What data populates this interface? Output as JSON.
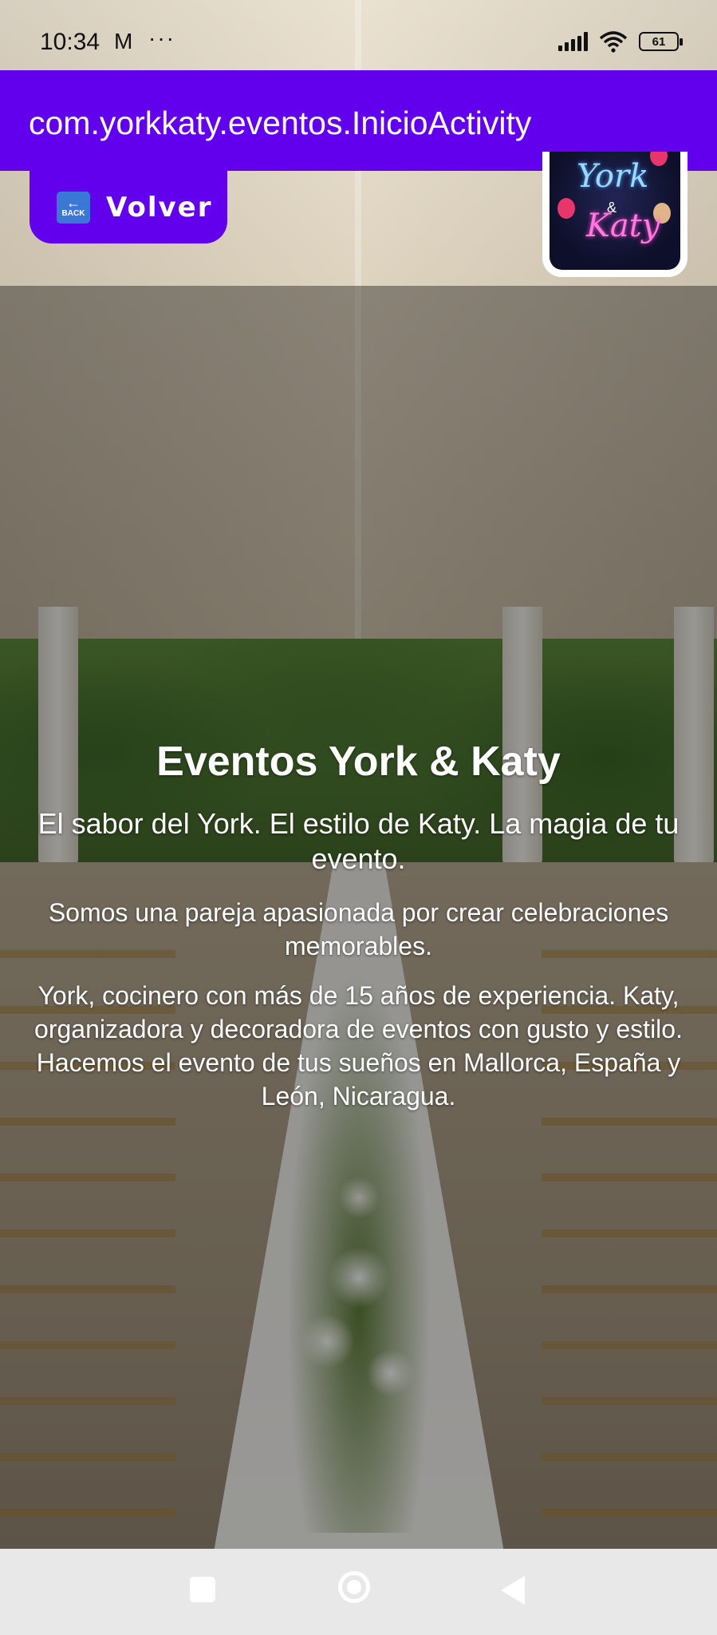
{
  "status_bar": {
    "time": "10:34",
    "mail_icon": "M",
    "more": "···",
    "battery": "61"
  },
  "action_bar": {
    "title": "com.yorkkaty.eventos.InicioActivity"
  },
  "back_button": {
    "icon_text": "BACK",
    "label": "Volver"
  },
  "logo": {
    "line1": "York",
    "line2": "&",
    "line3": "Katy"
  },
  "hero": {
    "title": "Eventos York & Katy",
    "tagline": "El sabor del York. El estilo de Katy. La magia de tu evento.",
    "paragraph1": "Somos una pareja apasionada por crear celebraciones memorables.",
    "paragraph2": "York, cocinero con más de 15 años de experiencia. Katy, organizadora y decoradora de eventos con gusto y estilo.",
    "paragraph3": "Hacemos el evento de tus sueños en Mallorca, España y León, Nicaragua."
  },
  "colors": {
    "primary": "#6200ee",
    "text_on_primary": "#ffffff",
    "nav_bar": "#e8e8e8"
  },
  "icons": {
    "back": "back-arrow-icon",
    "signal": "signal-icon",
    "wifi": "wifi-icon",
    "battery": "battery-icon",
    "nav_recents": "recents-icon",
    "nav_home": "home-icon",
    "nav_back": "nav-back-icon"
  }
}
